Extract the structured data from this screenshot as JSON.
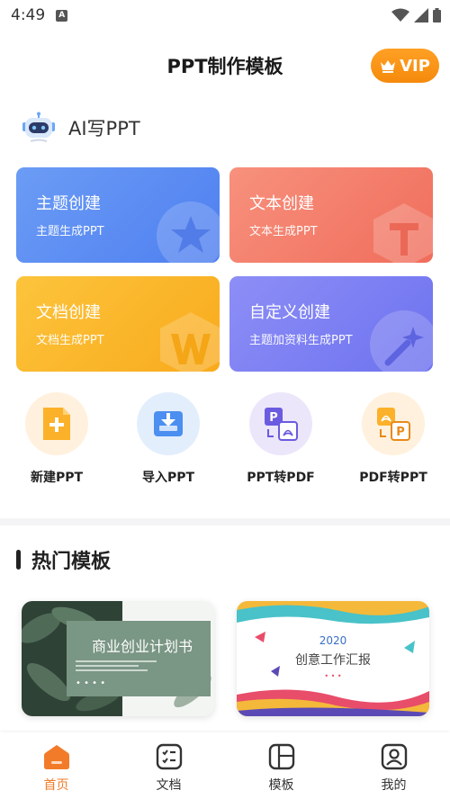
{
  "status_bar": {
    "time": "4:49",
    "notification_letter": "A"
  },
  "header": {
    "title": "PPT制作模板",
    "vip_label": "VIP"
  },
  "ai_section": {
    "label": "AI写PPT"
  },
  "cards": [
    {
      "title": "主题创建",
      "subtitle": "主题生成PPT",
      "icon": "star-icon"
    },
    {
      "title": "文本创建",
      "subtitle": "文本生成PPT",
      "icon": "letter-t-icon"
    },
    {
      "title": "文档创建",
      "subtitle": "文档生成PPT",
      "icon": "letter-w-icon"
    },
    {
      "title": "自定义创建",
      "subtitle": "主题加资料生成PPT",
      "icon": "magic-wand-icon"
    }
  ],
  "tools": [
    {
      "label": "新建PPT",
      "icon": "new-file-icon"
    },
    {
      "label": "导入PPT",
      "icon": "import-icon"
    },
    {
      "label": "PPT转PDF",
      "icon": "ppt-to-pdf-icon"
    },
    {
      "label": "PDF转PPT",
      "icon": "pdf-to-ppt-icon"
    }
  ],
  "hot_section": {
    "title": "热门模板"
  },
  "templates": [
    {
      "title": "商业创业计划书",
      "dots": "• • • •"
    },
    {
      "year": "2020",
      "title": "创意工作汇报",
      "dots": "• • •"
    }
  ],
  "tabbar": {
    "tabs": [
      {
        "label": "首页",
        "icon": "home-icon"
      },
      {
        "label": "文档",
        "icon": "document-list-icon"
      },
      {
        "label": "模板",
        "icon": "template-icon"
      },
      {
        "label": "我的",
        "icon": "profile-icon"
      }
    ],
    "active_color": "#f27b2a"
  },
  "colors": {
    "accent": "#f58a0c",
    "theme_card": "#5b8cf2",
    "text_card": "#f37f6b",
    "doc_card": "#fbb92c",
    "custom_card": "#7e80f3"
  }
}
